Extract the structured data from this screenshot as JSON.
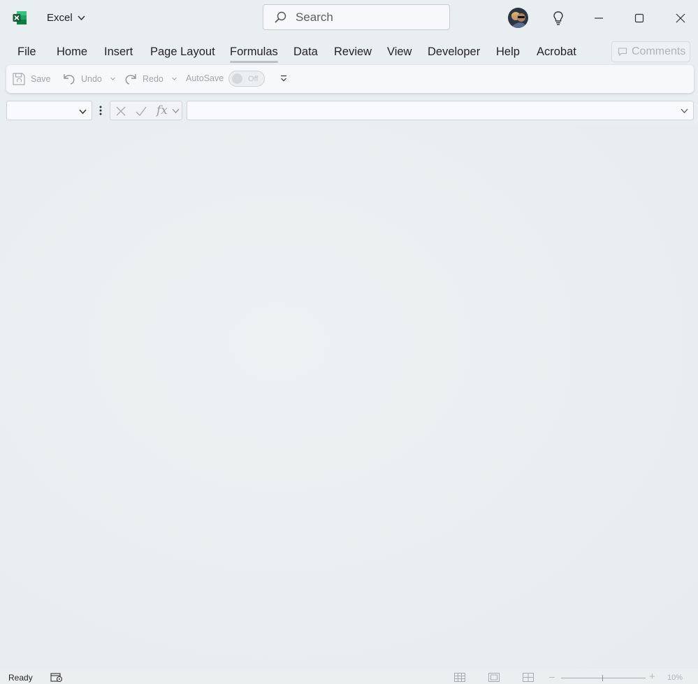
{
  "app": {
    "name": "Excel",
    "brand_color": "#107c41"
  },
  "search": {
    "placeholder": "Search"
  },
  "menu": {
    "tabs": [
      {
        "label": "File"
      },
      {
        "label": "Home"
      },
      {
        "label": "Insert"
      },
      {
        "label": "Page Layout"
      },
      {
        "label": "Formulas",
        "active": true
      },
      {
        "label": "Data"
      },
      {
        "label": "Review"
      },
      {
        "label": "View"
      },
      {
        "label": "Developer"
      },
      {
        "label": "Help"
      },
      {
        "label": "Acrobat"
      }
    ],
    "comments_label": "Comments"
  },
  "quick_access": {
    "save_label": "Save",
    "undo_label": "Undo",
    "redo_label": "Redo",
    "autosave_label": "AutoSave",
    "autosave_state": "Off"
  },
  "formula_bar": {
    "name_box_value": "",
    "formula_value": ""
  },
  "status": {
    "text": "Ready",
    "zoom": "10%"
  },
  "icons": {
    "app_logo": "excel-logo",
    "search": "search-icon",
    "bulb": "lightbulb-icon",
    "minimize": "minimize-icon",
    "maximize": "maximize-icon",
    "close": "close-icon"
  }
}
